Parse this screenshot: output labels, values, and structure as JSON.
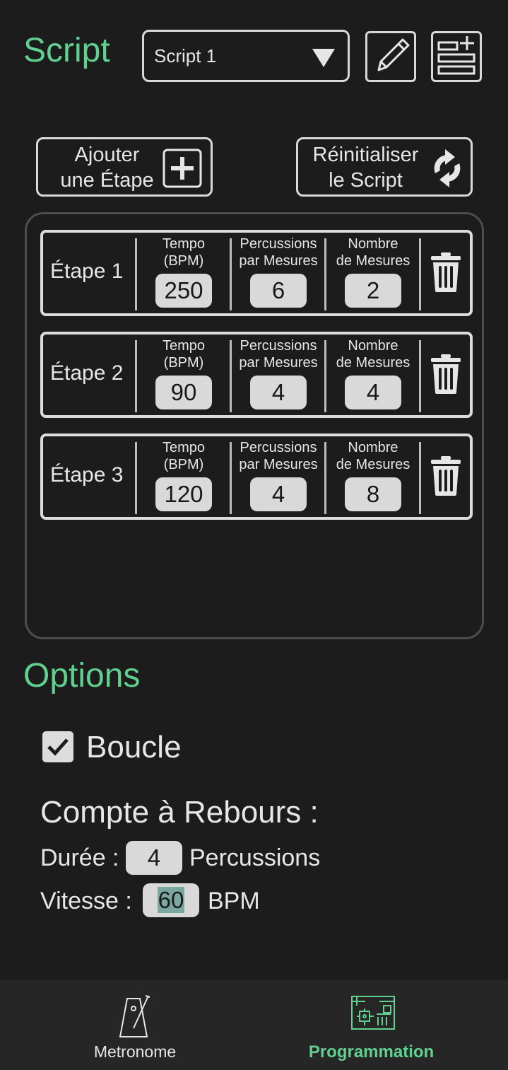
{
  "header": {
    "title": "Script",
    "script_select_value": "Script 1"
  },
  "actions": {
    "add_step_line1": "Ajouter",
    "add_step_line2": "une Étape",
    "reset_line1": "Réinitialiser",
    "reset_line2": "le Script"
  },
  "columns": {
    "tempo_line1": "Tempo",
    "tempo_line2": "(BPM)",
    "beats_line1": "Percussions",
    "beats_line2": "par Mesures",
    "measures_line1": "Nombre",
    "measures_line2": "de Mesures"
  },
  "steps": [
    {
      "name": "Étape 1",
      "tempo": "250",
      "beats": "6",
      "measures": "2"
    },
    {
      "name": "Étape 2",
      "tempo": "90",
      "beats": "4",
      "measures": "4"
    },
    {
      "name": "Étape 3",
      "tempo": "120",
      "beats": "4",
      "measures": "8"
    }
  ],
  "options": {
    "title": "Options",
    "loop_label": "Boucle",
    "loop_checked": true,
    "countdown_title": "Compte à Rebours :",
    "duration_label": "Durée :",
    "duration_value": "4",
    "duration_unit": "Percussions",
    "speed_label": "Vitesse :",
    "speed_value": "60",
    "speed_unit": "BPM"
  },
  "nav": {
    "metronome": "Metronome",
    "programmation": "Programmation",
    "active": "programmation"
  },
  "colors": {
    "accent": "#5fd08e",
    "background": "#1c1c1c",
    "field": "#d9d9d9"
  },
  "icons": [
    "chevron-down-icon",
    "pencil-icon",
    "add-list-icon",
    "plus-icon",
    "refresh-icon",
    "trash-icon",
    "check-icon",
    "metronome-icon",
    "circuit-board-icon"
  ]
}
